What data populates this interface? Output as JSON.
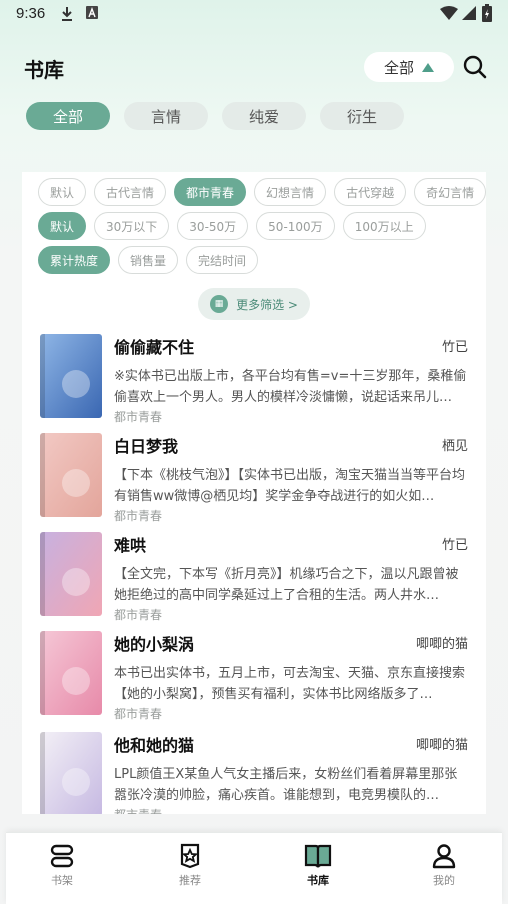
{
  "status_bar": {
    "time": "9:36"
  },
  "header": {
    "title": "书库",
    "dropdown_label": "全部"
  },
  "tabs": [
    {
      "label": "全部",
      "active": true
    },
    {
      "label": "言情",
      "active": false
    },
    {
      "label": "纯爱",
      "active": false
    },
    {
      "label": "衍生",
      "active": false
    }
  ],
  "filters": {
    "genre": [
      "默认",
      "古代言情",
      "都市青春",
      "幻想言情",
      "古代穿越",
      "奇幻言情"
    ],
    "genre_active": "都市青春",
    "wordcount": [
      "默认",
      "30万以下",
      "30-50万",
      "50-100万",
      "100万以上"
    ],
    "wordcount_active": "默认",
    "sort": [
      "累计热度",
      "销售量",
      "完结时间"
    ],
    "sort_active": "累计热度",
    "more_label": "更多筛选 >"
  },
  "books": [
    {
      "title": "偷偷藏不住",
      "author": "竹已",
      "desc": "※实体书已出版上市，各平台均有售=v=十三岁那年，桑稚偷偷喜欢上一个男人。男人的模样冷淡慵懒，说起话来吊儿…",
      "tag": "都市青春",
      "cover_colors": [
        "#8fb6e6",
        "#3a67b2"
      ]
    },
    {
      "title": "白日梦我",
      "author": "栖见",
      "desc": "【下本《桃枝气泡》】【实体书已出版，淘宝天猫当当等平台均有销售ww微博@栖见均】奖学金争夺战进行的如火如…",
      "tag": "都市青春",
      "cover_colors": [
        "#f2c9c4",
        "#e3a59b"
      ]
    },
    {
      "title": "难哄",
      "author": "竹已",
      "desc": "【全文完，下本写《折月亮》】机缘巧合之下，温以凡跟曾被她拒绝过的高中同学桑延过上了合租的生活。两人井水…",
      "tag": "都市青春",
      "cover_colors": [
        "#c7b1e0",
        "#f0a6b4"
      ]
    },
    {
      "title": "她的小梨涡",
      "author": "唧唧的猫",
      "desc": "本书已出实体书，五月上市，可去淘宝、天猫、京东直接搜索【她的小梨窝】，预售买有福利，实体书比网络版多了…",
      "tag": "都市青春",
      "cover_colors": [
        "#f5c7d6",
        "#e78aa9"
      ]
    },
    {
      "title": "他和她的猫",
      "author": "唧唧的猫",
      "desc": "LPL颜值王X某鱼人气女主播后来，女粉丝们看着屏幕里那张嚣张冷漠的帅脸，痛心疾首。谁能想到，电竞男模队的…",
      "tag": "都市青春",
      "cover_colors": [
        "#f3f0f6",
        "#c6b9e2"
      ]
    }
  ],
  "bottom_nav": [
    {
      "label": "书架",
      "icon": "bookshelf-icon",
      "active": false
    },
    {
      "label": "推荐",
      "icon": "star-icon",
      "active": false
    },
    {
      "label": "书库",
      "icon": "library-book-icon",
      "active": true
    },
    {
      "label": "我的",
      "icon": "profile-icon",
      "active": false
    }
  ]
}
